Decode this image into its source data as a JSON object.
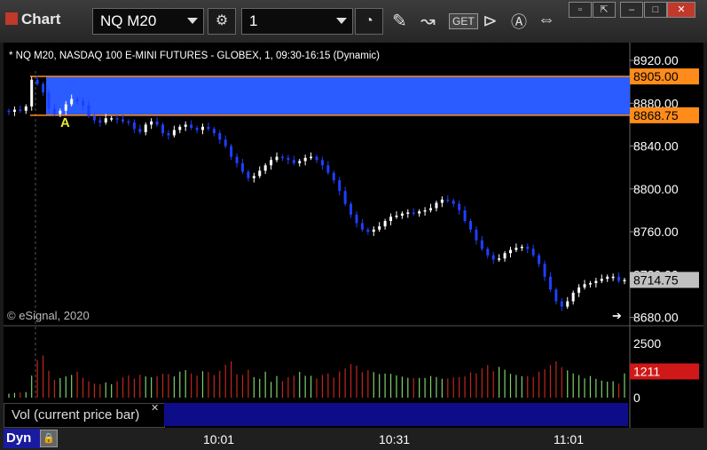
{
  "app": {
    "title": "Chart"
  },
  "toolbar": {
    "symbol": "NQ M20",
    "interval": "1",
    "get_label": "GET",
    "a_label": "A",
    "icons": [
      "settings-icon",
      "clock-icon",
      "pencil-icon",
      "study-icon",
      "get-icon",
      "play-icon",
      "alert-icon",
      "link-icon"
    ]
  },
  "window_buttons": [
    "restore",
    "pop-out",
    "maximize",
    "close"
  ],
  "chart": {
    "header": "* NQ M20, NASDAQ 100 E-MINI FUTURES - GLOBEX, 1, 09:30-16:15 (Dynamic)",
    "copyright": "© eSignal, 2020",
    "price_tags": {
      "upper": "8905.00",
      "lower": "8868.75",
      "last": "8714.75",
      "volume": "1211"
    },
    "annotation": "A",
    "colors": {
      "up_candle": "#ffffff",
      "down_candle": "#1f3fff",
      "zone": "#2a5cff",
      "zone_border": "#ff8c1a",
      "vol_up": "#7fd36a",
      "vol_down": "#c0261e",
      "last_tag": "#c0c0c0",
      "vol_tag": "#d01818"
    }
  },
  "volume": {
    "label": "Vol (current price bar)"
  },
  "footer": {
    "mode": "Dyn",
    "ticks": [
      "10:01",
      "10:31",
      "11:01"
    ]
  },
  "chart_data": {
    "type": "candlestick",
    "title": "NQ M20, NASDAQ 100 E-MINI FUTURES - GLOBEX, 1, 09:30-16:15 (Dynamic)",
    "y_ticks": [
      "8920.00",
      "8880.00",
      "8840.00",
      "8800.00",
      "8760.00",
      "8720.00",
      "8680.00"
    ],
    "ylim": [
      8678,
      8925
    ],
    "volume_ticks": [
      "2500",
      "0"
    ],
    "volume_ylim": [
      0,
      3200
    ],
    "zone": {
      "high": 8905.0,
      "low": 8868.75
    },
    "close_series": [
      8872,
      8874,
      8873,
      8877,
      8902,
      8898,
      8890,
      8875,
      8870,
      8873,
      8879,
      8884,
      8882,
      8878,
      8868,
      8864,
      8862,
      8866,
      8866,
      8865,
      8863,
      8862,
      8856,
      8853,
      8860,
      8863,
      8860,
      8852,
      8850,
      8855,
      8858,
      8860,
      8857,
      8855,
      8858,
      8856,
      8852,
      8846,
      8840,
      8830,
      8824,
      8816,
      8810,
      8812,
      8817,
      8822,
      8827,
      8830,
      8829,
      8827,
      8824,
      8826,
      8829,
      8830,
      8827,
      8822,
      8815,
      8808,
      8798,
      8786,
      8776,
      8768,
      8762,
      8760,
      8762,
      8765,
      8770,
      8774,
      8775,
      8777,
      8778,
      8777,
      8779,
      8780,
      8782,
      8787,
      8790,
      8789,
      8786,
      8780,
      8770,
      8762,
      8752,
      8744,
      8738,
      8734,
      8735,
      8740,
      8743,
      8745,
      8746,
      8744,
      8738,
      8730,
      8718,
      8706,
      8695,
      8690,
      8695,
      8703,
      8708,
      8711,
      8712,
      8714,
      8716,
      8718,
      8718,
      8714,
      8715
    ],
    "volume_series": [
      180,
      220,
      240,
      260,
      1020,
      1720,
      1950,
      1250,
      820,
      900,
      980,
      1050,
      1200,
      920,
      760,
      650,
      620,
      700,
      620,
      760,
      940,
      1030,
      880,
      1060,
      980,
      940,
      990,
      1100,
      1090,
      980,
      1200,
      1270,
      1120,
      1020,
      1220,
      1180,
      1040,
      1240,
      1520,
      1680,
      1080,
      1050,
      1290,
      950,
      870,
      1200,
      730,
      1000,
      760,
      950,
      1020,
      1190,
      1010,
      1010,
      890,
      1050,
      1120,
      930,
      1210,
      1350,
      1550,
      1480,
      1180,
      1270,
      1180,
      1090,
      1110,
      1100,
      1030,
      970,
      920,
      900,
      910,
      910,
      1000,
      950,
      870,
      890,
      930,
      950,
      980,
      1170,
      1120,
      1350,
      1510,
      1230,
      1420,
      1290,
      1100,
      1050,
      990,
      1000,
      950,
      1200,
      1310,
      1510,
      1680,
      1410,
      1260,
      1120,
      1040,
      890,
      1000,
      870,
      790,
      740,
      760,
      650,
      1120
    ]
  }
}
